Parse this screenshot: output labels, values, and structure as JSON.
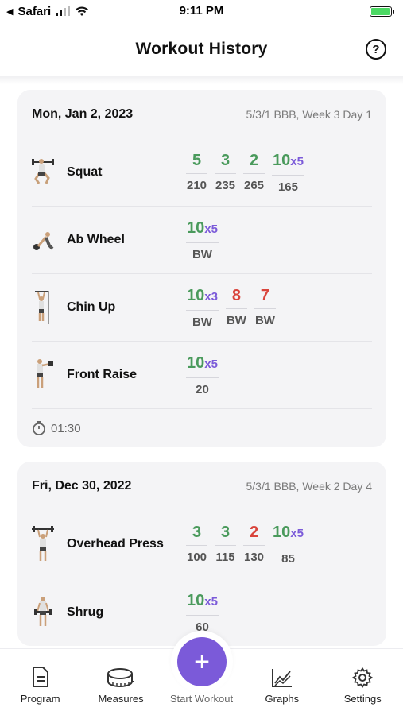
{
  "status_bar": {
    "back_app": "Safari",
    "time": "9:11 PM"
  },
  "header": {
    "title": "Workout History",
    "help_label": "?"
  },
  "colors": {
    "accent": "#7b5ad9",
    "success": "#4a9a5c",
    "fail": "#d9443c"
  },
  "workouts": [
    {
      "date": "Mon, Jan 2, 2023",
      "program": "5/3/1 BBB, Week 3 Day 1",
      "exercises": [
        {
          "name": "Squat",
          "icon": "squat-icon",
          "sets": [
            {
              "reps": "5",
              "mult": "",
              "weight": "210",
              "status": "green"
            },
            {
              "reps": "3",
              "mult": "",
              "weight": "235",
              "status": "green"
            },
            {
              "reps": "2",
              "mult": "",
              "weight": "265",
              "status": "green"
            },
            {
              "reps": "10",
              "mult": "x5",
              "weight": "165",
              "status": "green"
            }
          ]
        },
        {
          "name": "Ab Wheel",
          "icon": "ab-wheel-icon",
          "sets": [
            {
              "reps": "10",
              "mult": "x5",
              "weight": "BW",
              "status": "green"
            }
          ]
        },
        {
          "name": "Chin Up",
          "icon": "chin-up-icon",
          "sets": [
            {
              "reps": "10",
              "mult": "x3",
              "weight": "BW",
              "status": "green"
            },
            {
              "reps": "8",
              "mult": "",
              "weight": "BW",
              "status": "red"
            },
            {
              "reps": "7",
              "mult": "",
              "weight": "BW",
              "status": "red"
            }
          ]
        },
        {
          "name": "Front Raise",
          "icon": "front-raise-icon",
          "sets": [
            {
              "reps": "10",
              "mult": "x5",
              "weight": "20",
              "status": "green"
            }
          ]
        }
      ],
      "duration": "01:30"
    },
    {
      "date": "Fri, Dec 30, 2022",
      "program": "5/3/1 BBB, Week 2 Day 4",
      "exercises": [
        {
          "name": "Overhead Press",
          "icon": "overhead-press-icon",
          "sets": [
            {
              "reps": "3",
              "mult": "",
              "weight": "100",
              "status": "green"
            },
            {
              "reps": "3",
              "mult": "",
              "weight": "115",
              "status": "green"
            },
            {
              "reps": "2",
              "mult": "",
              "weight": "130",
              "status": "red"
            },
            {
              "reps": "10",
              "mult": "x5",
              "weight": "85",
              "status": "green"
            }
          ]
        },
        {
          "name": "Shrug",
          "icon": "shrug-icon",
          "sets": [
            {
              "reps": "10",
              "mult": "x5",
              "weight": "60",
              "status": "green"
            }
          ]
        }
      ]
    }
  ],
  "bottom_nav": {
    "program": "Program",
    "measures": "Measures",
    "start_workout": "Start Workout",
    "start_symbol": "+",
    "graphs": "Graphs",
    "settings": "Settings"
  }
}
